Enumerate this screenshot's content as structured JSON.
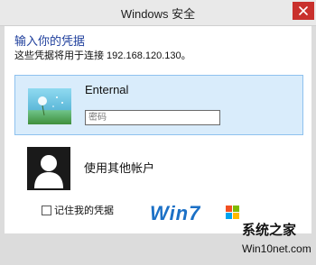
{
  "window": {
    "title": "Windows 安全"
  },
  "dialog": {
    "heading": "输入你的凭据",
    "subtext": "这些凭据将用于连接 192.168.120.130。"
  },
  "accounts": {
    "primary_name": "Enternal",
    "password_placeholder": "密码",
    "other_label": "使用其他帐户"
  },
  "remember": {
    "label": "记住我的凭据",
    "checked": false
  },
  "watermark": {
    "brand": "Win7",
    "name": "系统之家",
    "site": "Win10net.com"
  },
  "colors": {
    "heading": "#1f3f9c",
    "close_button": "#c9302c",
    "selected_card": "#d9ecfb",
    "watermark_brand": "#1b70c6"
  }
}
